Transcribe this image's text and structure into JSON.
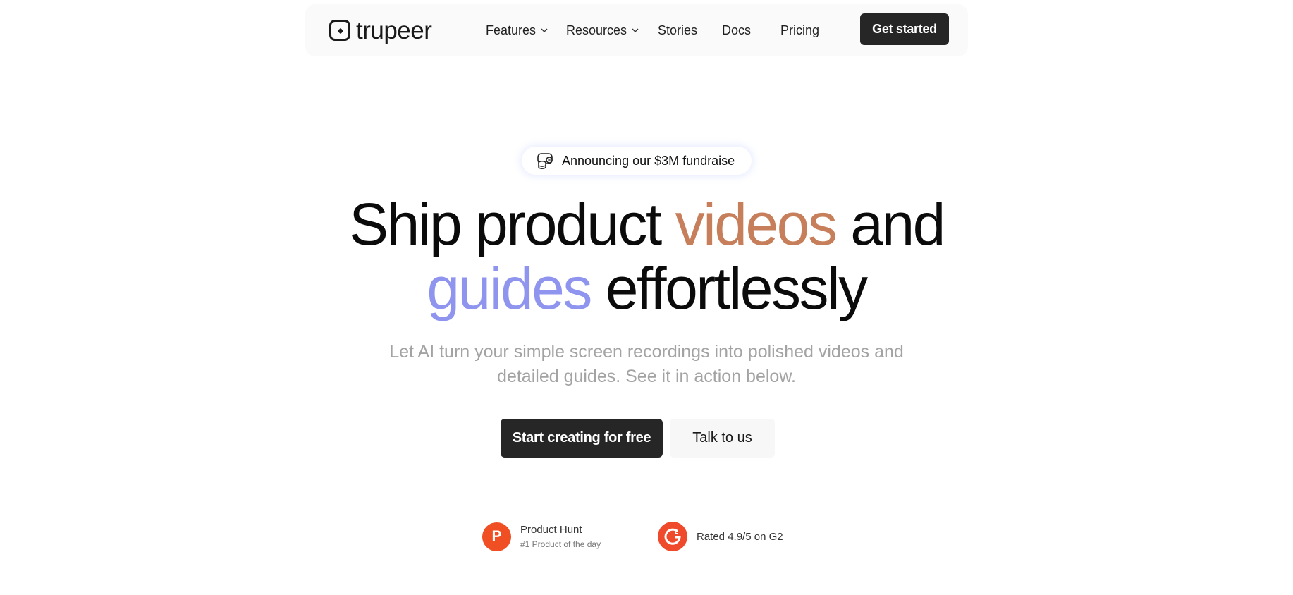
{
  "nav": {
    "logo_text": "trupeer",
    "items": [
      {
        "label": "Features",
        "has_dropdown": true
      },
      {
        "label": "Resources",
        "has_dropdown": true
      },
      {
        "label": "Stories",
        "has_dropdown": false
      },
      {
        "label": "Docs",
        "has_dropdown": false
      },
      {
        "label": "Pricing",
        "has_dropdown": false
      }
    ],
    "cta_label": "Get started"
  },
  "announcement": {
    "icon": "fundraise-icon",
    "text": "Announcing our $3M fundraise"
  },
  "hero": {
    "line1_part1": "Ship product ",
    "line1_accent": "videos",
    "line1_part2": " and",
    "line2_accent": "guides",
    "line2_part2": " effortlessly",
    "subtitle_line1": "Let AI turn your simple screen recordings into polished videos and",
    "subtitle_line2": "detailed guides. See it in action below.",
    "primary_cta": "Start creating for free",
    "secondary_cta": "Talk to us"
  },
  "social_proof": {
    "product_hunt": {
      "logo_letter": "P",
      "title": "Product Hunt",
      "subtitle": "#1 Product of the day"
    },
    "g2": {
      "text": "Rated 4.9/5 on G2"
    }
  },
  "colors": {
    "accent_orange": "#c67f5a",
    "accent_purple": "#8f95ee",
    "dark_button": "#262626",
    "product_hunt": "#ef4f23",
    "g2": "#ef4a2b"
  }
}
